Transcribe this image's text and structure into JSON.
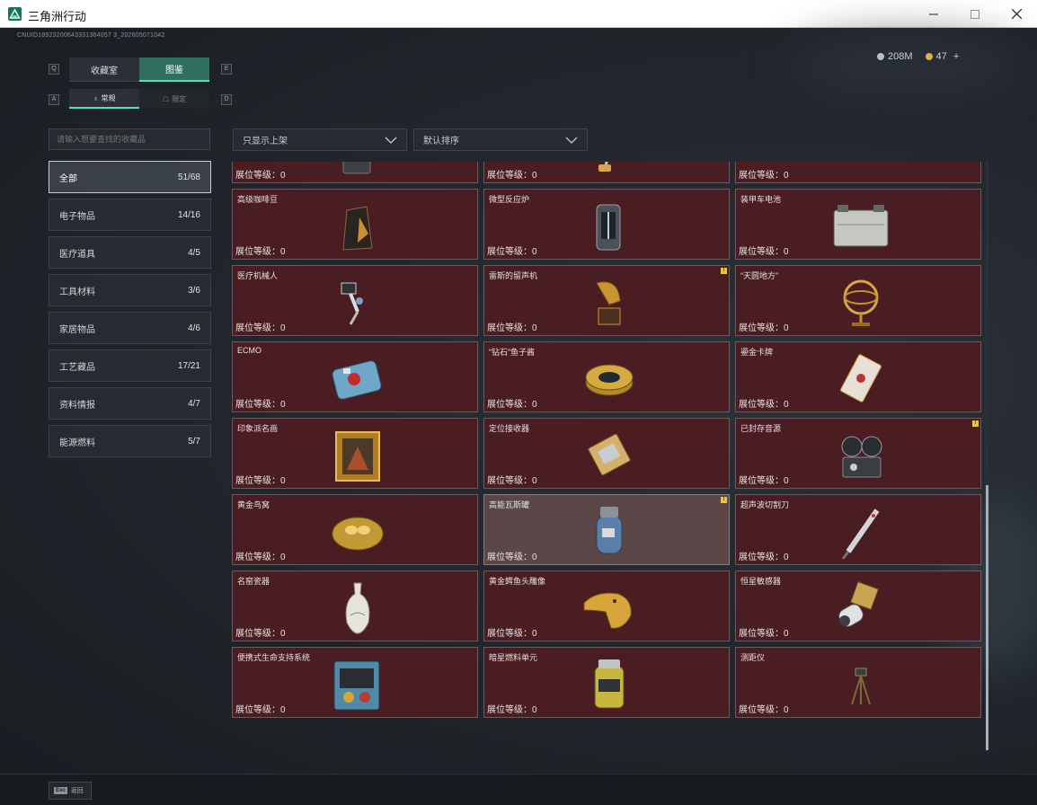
{
  "window": {
    "title": "三角洲行动",
    "min_icon": "minimize-icon",
    "max_icon": "maximize-icon",
    "close_icon": "close-icon"
  },
  "uid": "CNUID18923200643331364057 3_202605071042",
  "currency": {
    "money": "208M",
    "coins": "47",
    "add": "+"
  },
  "tabs": {
    "main": [
      {
        "label": "收藏室",
        "key": "Q",
        "active": false
      },
      {
        "label": "图鉴",
        "key": "E",
        "active": true
      }
    ],
    "sub": [
      {
        "label": "常规",
        "key": "A",
        "active": true
      },
      {
        "label": "限定",
        "key": "D",
        "active": false
      }
    ]
  },
  "search": {
    "placeholder": "请输入想要查找的收藏品"
  },
  "filters": {
    "display": "只显示上架",
    "sort": "默认排序"
  },
  "categories": [
    {
      "label": "全部",
      "count": "51/68",
      "active": true
    },
    {
      "label": "电子物品",
      "count": "14/16",
      "active": false
    },
    {
      "label": "医疗道具",
      "count": "4/5",
      "active": false
    },
    {
      "label": "工具材料",
      "count": "3/6",
      "active": false
    },
    {
      "label": "家居物品",
      "count": "4/6",
      "active": false
    },
    {
      "label": "工艺藏品",
      "count": "17/21",
      "active": false
    },
    {
      "label": "资料情报",
      "count": "4/7",
      "active": false
    },
    {
      "label": "能源燃料",
      "count": "5/7",
      "active": false
    }
  ],
  "level_label": "展位等级：0",
  "items": [
    {
      "name": "",
      "icon": "crate-icon",
      "badge": false
    },
    {
      "name": "",
      "icon": "vacuum-icon",
      "badge": false
    },
    {
      "name": "",
      "icon": "server-icon",
      "badge": false
    },
    {
      "name": "高级咖啡豆",
      "icon": "coffee-bag-icon",
      "badge": false
    },
    {
      "name": "微型反应炉",
      "icon": "reactor-icon",
      "badge": false
    },
    {
      "name": "装甲车电池",
      "icon": "battery-icon",
      "badge": false
    },
    {
      "name": "医疗机械人",
      "icon": "robot-arm-icon",
      "badge": false
    },
    {
      "name": "雷斯的留声机",
      "icon": "gramophone-icon",
      "badge": true
    },
    {
      "name": "“天圆地方”",
      "icon": "armillary-icon",
      "badge": false
    },
    {
      "name": "ECMO",
      "icon": "ecmo-icon",
      "badge": false
    },
    {
      "name": "“钻石”鱼子酱",
      "icon": "caviar-tin-icon",
      "badge": false
    },
    {
      "name": "鎏金卡牌",
      "icon": "card-icon",
      "badge": false
    },
    {
      "name": "印象派名画",
      "icon": "painting-icon",
      "badge": false
    },
    {
      "name": "定位接收器",
      "icon": "receiver-icon",
      "badge": false
    },
    {
      "name": "已封存音源",
      "icon": "film-reel-icon",
      "badge": true
    },
    {
      "name": "黄金鸟窝",
      "icon": "nest-icon",
      "badge": false
    },
    {
      "name": "高能瓦斯罐",
      "icon": "gas-tank-icon",
      "badge": true,
      "selected": true
    },
    {
      "name": "超声波切割刀",
      "icon": "scalpel-icon",
      "badge": false
    },
    {
      "name": "名窑瓷器",
      "icon": "vase-icon",
      "badge": false
    },
    {
      "name": "黄金鳄鱼头雕像",
      "icon": "croc-head-icon",
      "badge": false
    },
    {
      "name": "恒星敏感器",
      "icon": "sensor-icon",
      "badge": false
    },
    {
      "name": "便携式生命支持系统",
      "icon": "life-support-icon",
      "badge": false
    },
    {
      "name": "暗星燃料单元",
      "icon": "fuel-cell-icon",
      "badge": false
    },
    {
      "name": "测距仪",
      "icon": "tripod-icon",
      "badge": false
    }
  ],
  "bottom": {
    "esc_key": "Esc",
    "esc_label": "返回"
  },
  "colors": {
    "accent": "#5de0b5",
    "card_bg": "#4a1d22",
    "badge": "#e8c34a"
  }
}
